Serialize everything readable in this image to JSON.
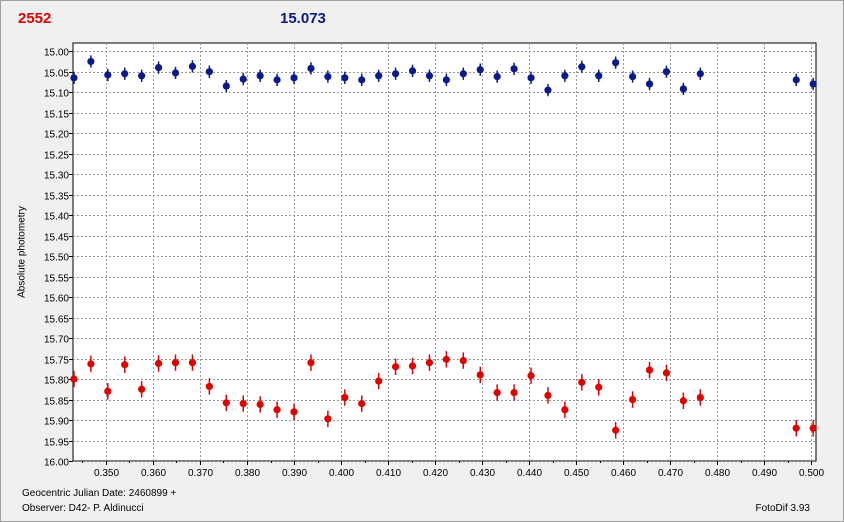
{
  "header": {
    "left_value": "2552",
    "right_value": "15.073"
  },
  "footer": {
    "julian_date": "Geocentric Julian Date: 2460899 +",
    "observer": "Observer: D42- P. Aldinucci",
    "software": "FotoDif 3.93"
  },
  "colors": {
    "red_series": "#e00000",
    "blue_series": "#0a1a8a",
    "grid": "#9a9a9a"
  },
  "chart_data": {
    "type": "scatter",
    "ylabel": "Absolute photometry",
    "xlabel": "",
    "xlim": [
      0.343,
      0.501
    ],
    "ylim": [
      16.0,
      14.98
    ],
    "y_inverted": true,
    "grid": true,
    "x_ticks": [
      "0.350",
      "0.360",
      "0.370",
      "0.380",
      "0.390",
      "0.400",
      "0.410",
      "0.420",
      "0.430",
      "0.440",
      "0.450",
      "0.460",
      "0.470",
      "0.480",
      "0.490",
      "0.500"
    ],
    "y_ticks": [
      "15.00",
      "15.05",
      "15.10",
      "15.15",
      "15.20",
      "15.25",
      "15.30",
      "15.35",
      "15.40",
      "15.45",
      "15.50",
      "15.55",
      "15.60",
      "15.65",
      "15.70",
      "15.75",
      "15.80",
      "15.85",
      "15.90",
      "15.95",
      "16.00"
    ],
    "series": [
      {
        "color": "#0a1a8a",
        "error": 0.015,
        "x": [
          0.3432,
          0.3468,
          0.3504,
          0.354,
          0.3576,
          0.3612,
          0.3648,
          0.3684,
          0.372,
          0.3756,
          0.3792,
          0.3828,
          0.3864,
          0.39,
          0.3936,
          0.3972,
          0.4008,
          0.4044,
          0.408,
          0.4116,
          0.4152,
          0.4188,
          0.4224,
          0.426,
          0.4296,
          0.4332,
          0.4368,
          0.4404,
          0.444,
          0.4476,
          0.4512,
          0.4548,
          0.4584,
          0.462,
          0.4656,
          0.4692,
          0.4728,
          0.4764,
          0.4968,
          0.5004
        ],
        "y": [
          15.065,
          15.025,
          15.058,
          15.055,
          15.06,
          15.04,
          15.053,
          15.037,
          15.05,
          15.085,
          15.068,
          15.06,
          15.07,
          15.065,
          15.042,
          15.062,
          15.065,
          15.07,
          15.06,
          15.055,
          15.048,
          15.06,
          15.07,
          15.055,
          15.045,
          15.062,
          15.043,
          15.065,
          15.095,
          15.06,
          15.038,
          15.06,
          15.028,
          15.062,
          15.08,
          15.05,
          15.092,
          15.055,
          15.07,
          15.08
        ]
      },
      {
        "color": "#e00000",
        "error": 0.02,
        "x": [
          0.3432,
          0.3468,
          0.3504,
          0.354,
          0.3576,
          0.3612,
          0.3648,
          0.3684,
          0.372,
          0.3756,
          0.3792,
          0.3828,
          0.3864,
          0.39,
          0.3936,
          0.3972,
          0.4008,
          0.4044,
          0.408,
          0.4116,
          0.4152,
          0.4188,
          0.4224,
          0.426,
          0.4296,
          0.4332,
          0.4368,
          0.4404,
          0.444,
          0.4476,
          0.4512,
          0.4548,
          0.4584,
          0.462,
          0.4656,
          0.4692,
          0.4728,
          0.4764,
          0.4968,
          0.5004
        ],
        "y": [
          15.8,
          15.763,
          15.83,
          15.765,
          15.825,
          15.762,
          15.76,
          15.76,
          15.818,
          15.858,
          15.86,
          15.862,
          15.875,
          15.88,
          15.76,
          15.897,
          15.845,
          15.86,
          15.805,
          15.77,
          15.768,
          15.76,
          15.752,
          15.755,
          15.79,
          15.833,
          15.833,
          15.792,
          15.84,
          15.875,
          15.808,
          15.82,
          15.925,
          15.85,
          15.778,
          15.785,
          15.853,
          15.845,
          15.92,
          15.92
        ]
      }
    ]
  }
}
